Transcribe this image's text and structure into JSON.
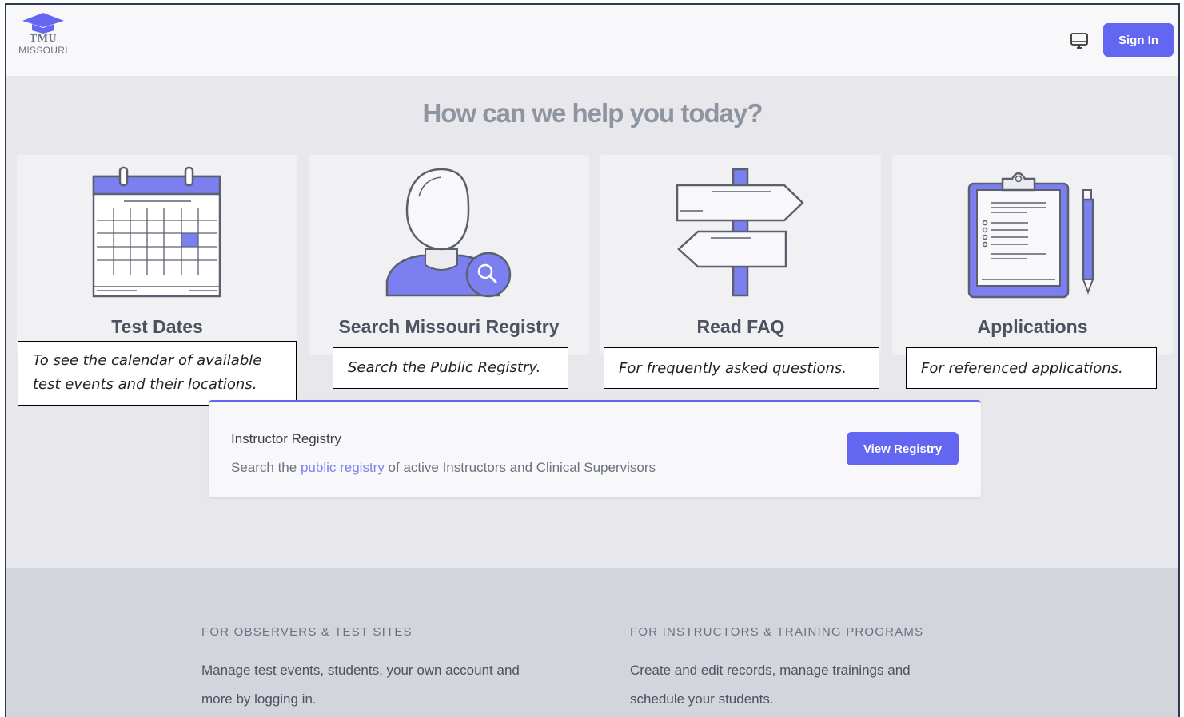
{
  "header": {
    "logo_line1": "TMU",
    "logo_line2": "MISSOURI",
    "signin_label": "Sign In"
  },
  "headline": "How can we help you today?",
  "cards": [
    {
      "title": "Test Dates",
      "icon": "calendar-icon",
      "note": "To see the calendar of available\ntest events and their locations."
    },
    {
      "title": "Search Missouri Registry",
      "icon": "person-search-icon",
      "note": "Search the Public Registry."
    },
    {
      "title": "Read FAQ",
      "icon": "signpost-icon",
      "note": "For frequently asked questions."
    },
    {
      "title": "Applications",
      "icon": "clipboard-icon",
      "note": "For referenced applications."
    }
  ],
  "registry": {
    "title": "Instructor Registry",
    "desc_before": "Search the ",
    "desc_link": "public registry",
    "desc_after": " of active Instructors and Clinical Supervisors",
    "button_label": "View Registry"
  },
  "footer": {
    "left_heading": "FOR OBSERVERS & TEST SITES",
    "left_text_line1": "Manage test events, students, your own account and",
    "left_text_line2": "more by logging in.",
    "right_heading": "FOR INSTRUCTORS & TRAINING PROGRAMS",
    "right_text_line1": "Create and edit records, manage trainings and",
    "right_text_line2": "schedule your students."
  },
  "colors": {
    "accent": "#6366f1",
    "icon_fill": "#7b7ff0",
    "icon_stroke": "#5a606d"
  }
}
